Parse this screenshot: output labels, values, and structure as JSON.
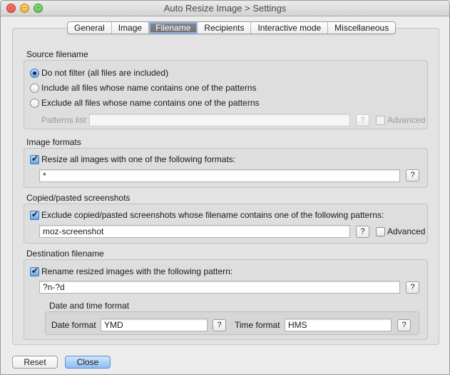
{
  "window": {
    "title": "Auto Resize Image > Settings"
  },
  "tabs": [
    {
      "label": "General",
      "active": false
    },
    {
      "label": "Image",
      "active": false
    },
    {
      "label": "Filename",
      "active": true
    },
    {
      "label": "Recipients",
      "active": false
    },
    {
      "label": "Interactive mode",
      "active": false
    },
    {
      "label": "Miscellaneous",
      "active": false
    }
  ],
  "source": {
    "title": "Source filename",
    "options": [
      {
        "label": "Do not filter (all files are included)",
        "selected": true
      },
      {
        "label": "Include all files whose name contains one of the patterns",
        "selected": false
      },
      {
        "label": "Exclude all files whose name contains one of the patterns",
        "selected": false
      }
    ],
    "patterns_label": "Patterns list",
    "patterns_value": "",
    "help_label": "?",
    "advanced_label": "Advanced",
    "advanced_checked": false
  },
  "formats": {
    "title": "Image formats",
    "checkbox_label": "Resize all images with one of the following formats:",
    "checked": true,
    "value": "*",
    "help_label": "?"
  },
  "screenshots": {
    "title": "Copied/pasted screenshots",
    "checkbox_label": "Exclude copied/pasted screenshots whose filename contains one of the following patterns:",
    "checked": true,
    "value": "moz-screenshot",
    "help_label": "?",
    "advanced_label": "Advanced",
    "advanced_checked": false
  },
  "destination": {
    "title": "Destination filename",
    "checkbox_label": "Rename resized images with the following pattern:",
    "checked": true,
    "value": "?n-?d",
    "help_label": "?",
    "datetime": {
      "title": "Date and time format",
      "date_label": "Date format",
      "date_value": "YMD",
      "time_label": "Time format",
      "time_value": "HMS",
      "help_label": "?"
    }
  },
  "buttons": {
    "reset": "Reset",
    "close": "Close"
  }
}
